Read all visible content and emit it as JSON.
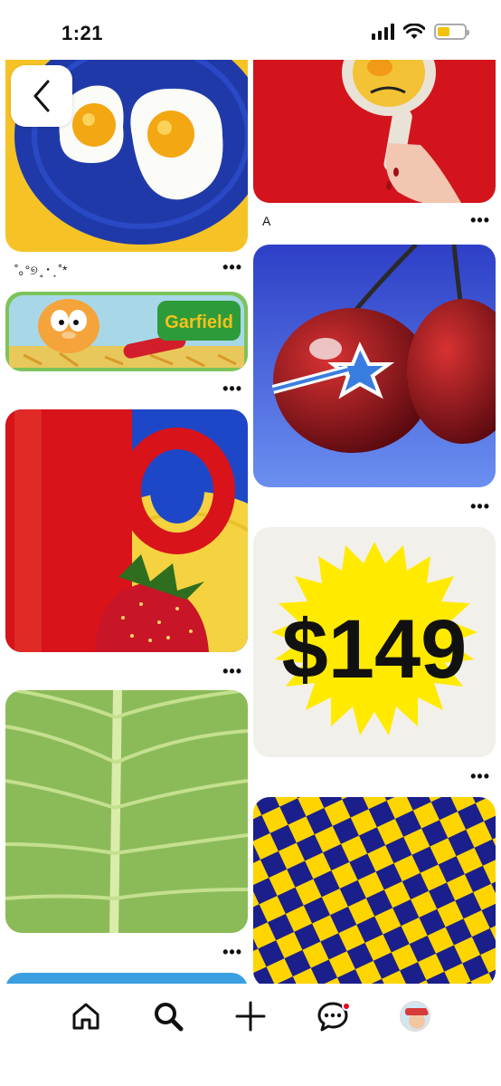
{
  "status_bar": {
    "time": "1:21"
  },
  "pins": {
    "eggs_title": "˚｡°୭ ̥ ･ ͙ ˚*",
    "mirror_title": "A",
    "price_text": "$149",
    "garfield_text": "Garfield",
    "more_label": "•••"
  },
  "icons": {
    "back": "chevron-left-icon",
    "home": "home-icon",
    "search": "search-icon",
    "create": "plus-icon",
    "messages": "chat-bubble-icon",
    "profile": "avatar"
  },
  "colors": {
    "accent_red": "#e60023",
    "yellow": "#f4c20d",
    "blue": "#1f3aa8"
  }
}
